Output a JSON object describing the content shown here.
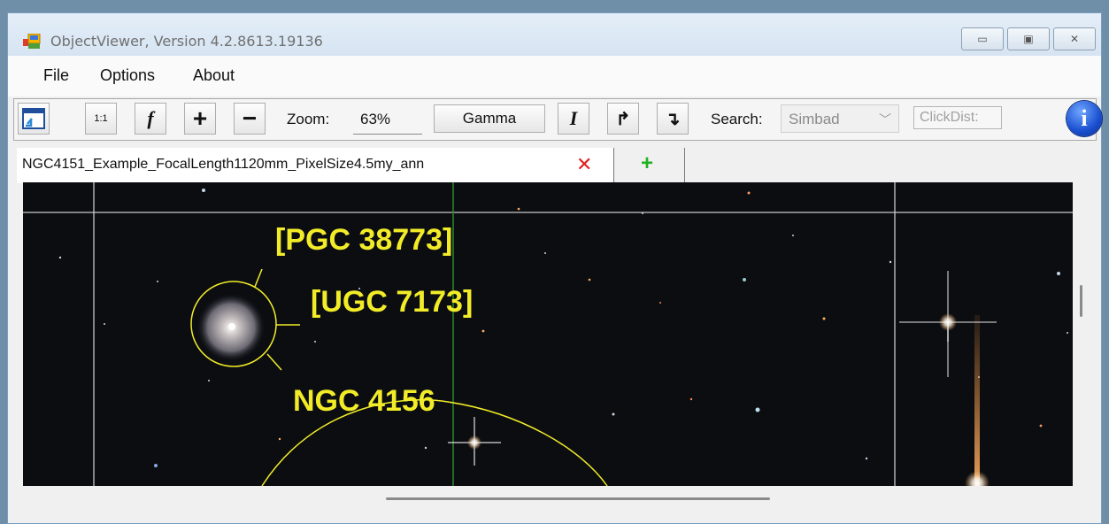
{
  "window": {
    "title": "ObjectViewer, Version 4.2.8613.19136",
    "controls": {
      "minimize": "▭",
      "maximize": "▣",
      "close": "✕"
    }
  },
  "menu": {
    "items": [
      "File",
      "Options",
      "About"
    ]
  },
  "toolbar": {
    "fit_icon": "window-fit-icon",
    "one_to_one": "1:1",
    "function": "f",
    "zoom_in": "+",
    "zoom_out": "−",
    "zoom_label": "Zoom:",
    "zoom_value": "63%",
    "gamma_label": "Gamma",
    "invert": "I",
    "flip_h": "↱",
    "flip_v": "↴",
    "search_label": "Search:",
    "search_value": "Simbad",
    "clickdist_placeholder": "ClickDist:",
    "info": "i"
  },
  "tabs": {
    "active_label": "NGC4151_Example_FocalLength1120mm_PixelSize4.5my_ann",
    "close": "✕",
    "add": "+"
  },
  "image": {
    "annotations": [
      {
        "label": "[PGC 38773]"
      },
      {
        "label": "[UGC 7173]"
      },
      {
        "label": "NGC 4156"
      }
    ],
    "annotation_color": "#f2ec28"
  }
}
